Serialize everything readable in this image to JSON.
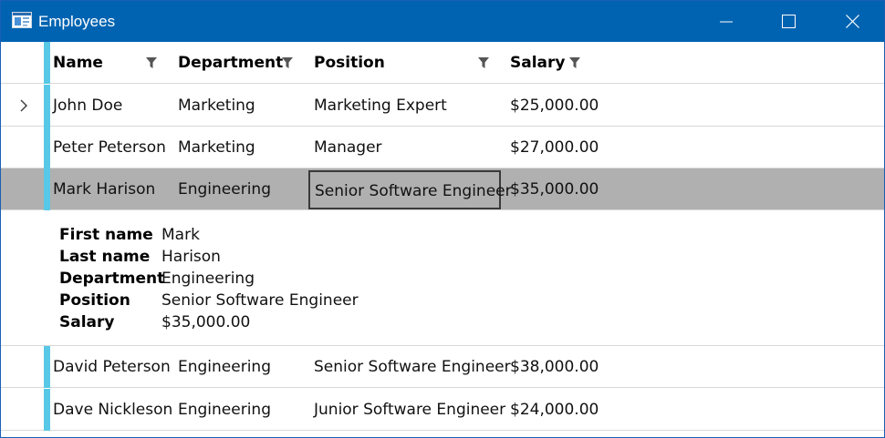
{
  "window": {
    "title": "Employees"
  },
  "columns": [
    {
      "label": "Name"
    },
    {
      "label": "Department"
    },
    {
      "label": "Position"
    },
    {
      "label": "Salary"
    }
  ],
  "rows": [
    {
      "name": "John Doe",
      "department": "Marketing",
      "position": "Marketing Expert",
      "salary": "$25,000.00"
    },
    {
      "name": "Peter Peterson",
      "department": "Marketing",
      "position": "Manager",
      "salary": "$27,000.00"
    },
    {
      "name": "Mark Harison",
      "department": "Engineering",
      "position": "Senior Software Engineer",
      "salary": "$35,000.00"
    },
    {
      "name": "David Peterson",
      "department": "Engineering",
      "position": "Senior Software Engineer",
      "salary": "$38,000.00"
    },
    {
      "name": "Dave Nickleson",
      "department": "Engineering",
      "position": "Junior Software Engineer",
      "salary": "$24,000.00"
    }
  ],
  "details": {
    "labels": {
      "first_name": "First name",
      "last_name": "Last name",
      "department": "Department",
      "position": "Position",
      "salary": "Salary"
    },
    "values": {
      "first_name": "Mark",
      "last_name": "Harison",
      "department": "Engineering",
      "position": "Senior Software Engineer",
      "salary": "$35,000.00"
    }
  },
  "icons": {
    "app": "window-app-icon",
    "minimize": "minimize-icon",
    "maximize": "maximize-icon",
    "close": "close-icon",
    "filter": "filter-funnel-icon",
    "current_row": "chevron-right-icon"
  },
  "colors": {
    "titlebar": "#0063b1",
    "accent": "#58c8e6",
    "selected_row": "#b0b0b0"
  }
}
